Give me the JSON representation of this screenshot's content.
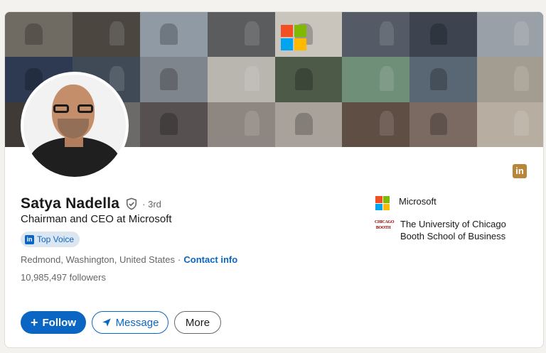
{
  "profile": {
    "name": "Satya Nadella",
    "degree": "· 3rd",
    "headline": "Chairman and CEO at Microsoft",
    "badge": "Top Voice",
    "location": "Redmond, Washington, United States",
    "separator": "·",
    "contact_label": "Contact info",
    "followers": "10,985,497 followers"
  },
  "actions": {
    "follow_label": "Follow",
    "message_label": "Message",
    "more_label": "More"
  },
  "organizations": [
    {
      "name": "Microsoft",
      "icon": "microsoft-logo"
    },
    {
      "name": "The University of Chicago Booth School of Business",
      "icon": "chicago-booth-logo",
      "logo_text": "CHICAGO BOOTH"
    }
  ],
  "icons": {
    "linkedin": "in",
    "badge": "in",
    "verified": "shield-check-icon",
    "follow": "+",
    "message": "send-icon"
  },
  "colors": {
    "primary_blue": "#0a66c2",
    "badge_bg": "#dce6f1",
    "linkedin_gold": "#b7863a",
    "ms_red": "#f25022",
    "ms_green": "#7fba00",
    "ms_blue": "#00a4ef",
    "ms_yellow": "#ffb900"
  }
}
